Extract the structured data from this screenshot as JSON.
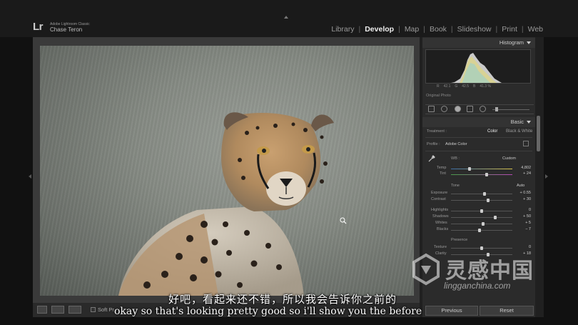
{
  "app": {
    "logo": "Lr",
    "product_name": "Adobe Lightroom Classic",
    "user_name": "Chase Teron"
  },
  "modules": [
    {
      "label": "Library",
      "active": false
    },
    {
      "label": "Develop",
      "active": true
    },
    {
      "label": "Map",
      "active": false
    },
    {
      "label": "Book",
      "active": false
    },
    {
      "label": "Slideshow",
      "active": false
    },
    {
      "label": "Print",
      "active": false
    },
    {
      "label": "Web",
      "active": false
    }
  ],
  "module_separator": "|",
  "toolbar": {
    "soft_proofing_label": "Soft Pr"
  },
  "histogram": {
    "title": "Histogram",
    "readout": [
      "R",
      "42.1",
      "G",
      "42.5",
      "B",
      "41.3 %"
    ],
    "original_photo_label": "Original Photo"
  },
  "basic": {
    "title": "Basic",
    "treatment_label": "Treatment :",
    "treatment_color": "Color",
    "treatment_bw": "Black & White",
    "profile_label": "Profile :",
    "profile_value": "Adobe Color",
    "wb_label": "WB :",
    "wb_value": "Custom",
    "temp_label": "Temp",
    "temp_value": "4,802",
    "temp_level": 0.3,
    "tint_label": "Tint",
    "tint_value": "+ 24",
    "tint_level": 0.58,
    "tone_label": "Tone",
    "tone_auto": "Auto",
    "exposure_label": "Exposure",
    "exposure_value": "+ 0.55",
    "exposure_level": 0.55,
    "contrast_label": "Contrast",
    "contrast_value": "+ 30",
    "contrast_level": 0.6,
    "highlights_label": "Highlights",
    "highlights_value": "0",
    "highlights_level": 0.5,
    "shadows_label": "Shadows",
    "shadows_value": "+ 50",
    "shadows_level": 0.72,
    "whites_label": "Whites",
    "whites_value": "+ 5",
    "whites_level": 0.52,
    "blacks_label": "Blacks",
    "blacks_value": "− 7",
    "blacks_level": 0.47,
    "presence_label": "Presence",
    "texture_label": "Texture",
    "texture_value": "0",
    "texture_level": 0.5,
    "clarity_label": "Clarity",
    "clarity_value": "+ 18",
    "clarity_level": 0.6
  },
  "panel_buttons": {
    "previous": "Previous",
    "reset": "Reset"
  },
  "subtitles": {
    "chinese": "好吧，看起来还不错，所以我会告诉你之前的",
    "english": "okay so that's looking pretty good so i'll show you the before"
  },
  "watermark": {
    "name": "灵感中国",
    "url": "lingganchina.com"
  }
}
